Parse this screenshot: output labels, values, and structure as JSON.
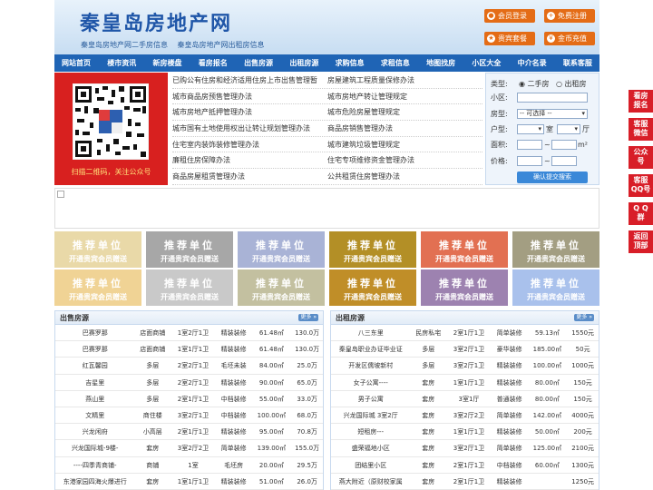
{
  "header": {
    "title": "秦皇岛房地产网",
    "links": [
      "秦皇岛房地产网二手房信息",
      "秦皇岛房地产网出租房信息"
    ],
    "buttons": [
      {
        "label": "会员登录",
        "icon": "person-icon"
      },
      {
        "label": "免费注册",
        "icon": "person-add-icon"
      },
      {
        "label": "贵宾套餐",
        "icon": "star-icon"
      },
      {
        "label": "金币充值",
        "icon": "coin-icon"
      }
    ]
  },
  "nav": [
    "网站首页",
    "楼市资讯",
    "新房楼盘",
    "看房报名",
    "出售房源",
    "出租房源",
    "求购信息",
    "求租信息",
    "地图找房",
    "小区大全",
    "中介名录",
    "联系客服"
  ],
  "qr": {
    "caption": "扫描二维码，关注公众号"
  },
  "laws": [
    [
      "已购公有住房和经济适用住房上市出售管理暂",
      "房屋建筑工程质量保修办法"
    ],
    [
      "城市商品房预售管理办法",
      "城市房地产转让管理规定"
    ],
    [
      "城市房地产抵押管理办法",
      "城市危险房屋管理规定"
    ],
    [
      "城市国有土地使用权出让转让规划管理办法",
      "商品房销售管理办法"
    ],
    [
      "住宅室内装饰装修管理办法",
      "城市建筑垃圾管理规定"
    ],
    [
      "廉租住房保障办法",
      "住宅专项维修资金管理办法"
    ],
    [
      "商品房屋租赁管理办法",
      "公共租赁住房管理办法"
    ]
  ],
  "search": {
    "type_label": "类型:",
    "opt_sale": "二手房",
    "opt_rent": "出租房",
    "community_label": "小区:",
    "room_label": "房型:",
    "room_value": "-- 可选择 --",
    "layout_label": "户型:",
    "layout_unit1": "室",
    "layout_unit2": "厅",
    "area_label": "面积:",
    "area_unit": "m²",
    "price_label": "价格:",
    "price_sep": "~",
    "submit": "确认提交搜索"
  },
  "recommend": {
    "title": "推荐单位",
    "sub": "开通贵宾会员赠送",
    "colors": [
      "#e9d9a8",
      "#a7a7a7",
      "#a9b3d6",
      "#b38f26",
      "#e27052",
      "#a39e82",
      "#f0d395",
      "#c9c9c9",
      "#c3c0a0",
      "#c08e28",
      "#9d82b0",
      "#a9c1ec"
    ]
  },
  "sale": {
    "title": "出售房源",
    "more": "更多 »",
    "rows": [
      [
        "巴赛罗那",
        "店面商铺",
        "1室2厅1卫",
        "精装装修",
        "61.48㎡",
        "130.0万"
      ],
      [
        "巴赛罗那",
        "店面商铺",
        "1室1厅1卫",
        "精装装修",
        "61.48㎡",
        "130.0万"
      ],
      [
        "红瓦馨园",
        "多层",
        "2室2厅1卫",
        "毛坯未装",
        "84.00㎡",
        "25.0万"
      ],
      [
        "吉星里",
        "多层",
        "2室2厅1卫",
        "精装装修",
        "90.00㎡",
        "65.0万"
      ],
      [
        "燕山里",
        "多层",
        "2室1厅1卫",
        "中档装修",
        "55.00㎡",
        "33.0万"
      ],
      [
        "文精里",
        "商住楼",
        "3室2厅1卫",
        "中档装修",
        "100.00㎡",
        "68.0万"
      ],
      [
        "兴龙闲府",
        "小高层",
        "2室1厅1卫",
        "精装装修",
        "95.00㎡",
        "70.8万"
      ],
      [
        "兴龙国际城-9楼-",
        "套房",
        "3室2厅2卫",
        "简单装修",
        "139.00㎡",
        "155.0万"
      ],
      [
        "----四季青商铺-",
        "商铺",
        "1室",
        "毛坯房",
        "20.00㎡",
        "29.5万"
      ],
      [
        "东港家园四海火爆进行",
        "套房",
        "1室1厅1卫",
        "精装装修",
        "51.00㎡",
        "26.0万"
      ]
    ]
  },
  "rent": {
    "title": "出租房源",
    "more": "更多 »",
    "rows": [
      [
        "八三东里",
        "民房私宅",
        "2室1厅1卫",
        "简单装修",
        "59.13㎡",
        "1550元"
      ],
      [
        "秦皇岛职业办证毕业证",
        "多层",
        "3室2厅1卫",
        "豪华装修",
        "185.00㎡",
        "50元"
      ],
      [
        "开发区儒坡新村",
        "多层",
        "3室2厅1卫",
        "精装装修",
        "100.00㎡",
        "1000元"
      ],
      [
        "女子公寓----",
        "套房",
        "1室1厅1卫",
        "精装装修",
        "80.00㎡",
        "150元"
      ],
      [
        "男子公寓",
        "套房",
        "3室1厅",
        "普通装修",
        "80.00㎡",
        "150元"
      ],
      [
        "兴龙国际城 3室2厅",
        "套房",
        "3室2厅2卫",
        "简单装修",
        "142.00㎡",
        "4000元"
      ],
      [
        "短租房---",
        "套房",
        "1室1厅1卫",
        "精装装修",
        "50.00㎡",
        "200元"
      ],
      [
        "盛荣福地小区",
        "套房",
        "3室2厅1卫",
        "简单装修",
        "125.00㎡",
        "2100元"
      ],
      [
        "团结里小区",
        "套房",
        "2室1厅1卫",
        "中档装修",
        "60.00㎡",
        "1300元"
      ],
      [
        "燕大附近（原财校家属",
        "套房",
        "2室1厅1卫",
        "精装装修",
        "",
        "1250元"
      ]
    ]
  },
  "sidebar": [
    "看房\n报名",
    "客服\n微信",
    "公众\n号",
    "客服\nQQ号",
    "Q Q\n群",
    "返回\n顶部"
  ]
}
